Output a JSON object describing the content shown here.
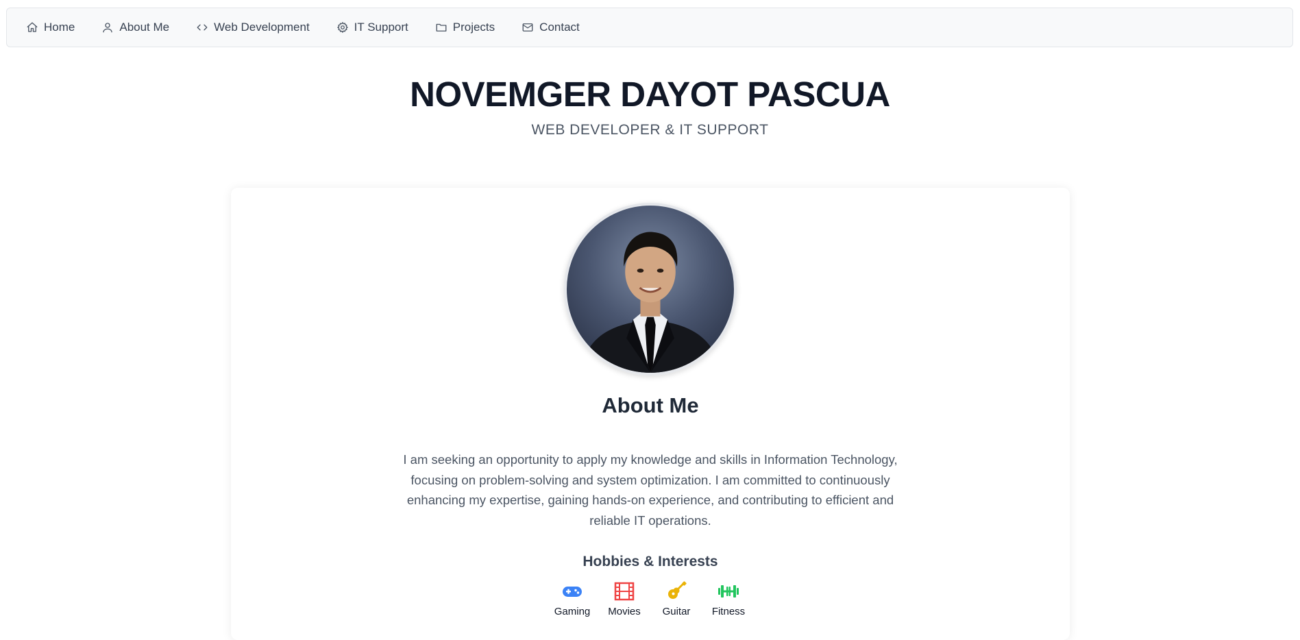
{
  "nav": {
    "items": [
      {
        "label": "Home",
        "icon": "home-icon"
      },
      {
        "label": "About Me",
        "icon": "user-icon"
      },
      {
        "label": "Web Development",
        "icon": "code-icon"
      },
      {
        "label": "IT Support",
        "icon": "gear-icon"
      },
      {
        "label": "Projects",
        "icon": "folder-icon"
      },
      {
        "label": "Contact",
        "icon": "envelope-icon"
      }
    ]
  },
  "header": {
    "title": "NOVEMGER DAYOT PASCUA",
    "subtitle": "WEB DEVELOPER & IT SUPPORT"
  },
  "about": {
    "heading": "About Me",
    "text": "I am seeking an opportunity to apply my knowledge and skills in Information Technology, focusing on problem-solving and system optimization. I am committed to continuously enhancing my expertise, gaining hands-on experience, and contributing to efficient and reliable IT operations.",
    "hobbies_heading": "Hobbies & Interests",
    "hobbies": [
      {
        "label": "Gaming",
        "icon": "gamepad-icon",
        "color": "#3b82f6"
      },
      {
        "label": "Movies",
        "icon": "film-icon",
        "color": "#ef4444"
      },
      {
        "label": "Guitar",
        "icon": "guitar-icon",
        "color": "#eab308"
      },
      {
        "label": "Fitness",
        "icon": "dumbbell-icon",
        "color": "#22c55e"
      }
    ]
  }
}
